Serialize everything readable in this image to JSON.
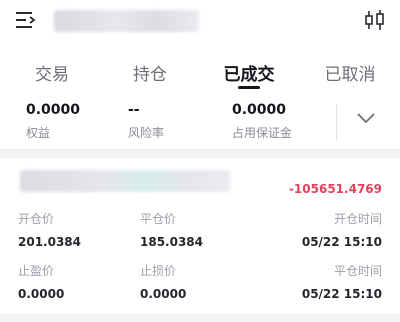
{
  "header": {
    "menu_icon": "menu-list-icon",
    "title": "",
    "chart_icon": "candlestick-icon"
  },
  "tabs": [
    {
      "label": "交易"
    },
    {
      "label": "持仓"
    },
    {
      "label": "已成交",
      "active": true
    },
    {
      "label": "已取消"
    }
  ],
  "summary": {
    "equity": {
      "value": "0.0000",
      "label": "权益"
    },
    "risk_rate": {
      "value": "--",
      "label": "风险率"
    },
    "margin_used": {
      "value": "0.0000",
      "label": "占用保证金"
    },
    "expand_icon": "chevron-down-icon"
  },
  "trade": {
    "symbol": "",
    "pnl": "-105651.4769",
    "open_price": {
      "label": "开仓价",
      "value": "201.0384"
    },
    "close_price": {
      "label": "平仓价",
      "value": "185.0384"
    },
    "open_time": {
      "label": "开仓时间",
      "value": "05/22 15:10"
    },
    "take_profit": {
      "label": "止盈价",
      "value": "0.0000"
    },
    "stop_loss": {
      "label": "止损价",
      "value": "0.0000"
    },
    "close_time": {
      "label": "平仓时间",
      "value": "05/22 15:10"
    }
  },
  "colors": {
    "loss": "#e0435a",
    "text": "#15161b",
    "muted": "#9c9fa8"
  }
}
